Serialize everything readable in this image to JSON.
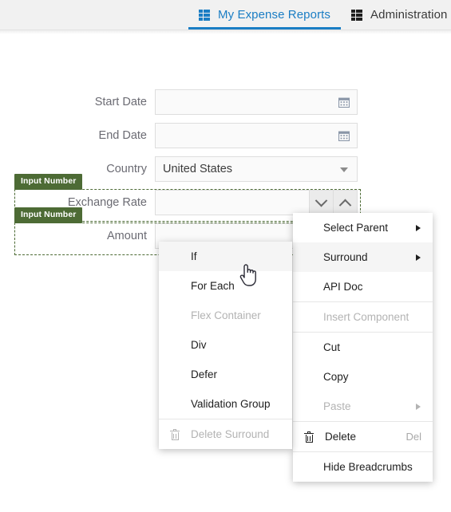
{
  "topbar": {
    "tabs": [
      {
        "label": "My Expense Reports",
        "icon": "grid-icon",
        "active": true
      },
      {
        "label": "Administration",
        "icon": "grid-icon",
        "active": false
      }
    ],
    "accent_color": "#1a7dc4"
  },
  "form": {
    "fields": [
      {
        "label": "Start Date",
        "value": "",
        "type": "date",
        "icon": "calendar-icon"
      },
      {
        "label": "End Date",
        "value": "",
        "type": "date",
        "icon": "calendar-icon"
      },
      {
        "label": "Country",
        "value": "United States",
        "type": "select",
        "icon": "chevron-down-icon"
      },
      {
        "label": "Exchange Rate",
        "value": "",
        "type": "number",
        "icon": "spinner-icon"
      },
      {
        "label": "Amount",
        "value": "",
        "type": "number",
        "icon": "spinner-icon"
      }
    ]
  },
  "designer": {
    "badges": [
      {
        "label": "Input Number"
      },
      {
        "label": "Input Number"
      }
    ],
    "selection_color": "#4d6b35"
  },
  "context_menu": {
    "items": [
      {
        "label": "Select Parent",
        "submenu": true,
        "disabled": false,
        "highlight": false,
        "accel": "",
        "icon": ""
      },
      {
        "label": "Surround",
        "submenu": true,
        "disabled": false,
        "highlight": true,
        "accel": "",
        "icon": ""
      },
      {
        "label": "API Doc",
        "submenu": false,
        "disabled": false,
        "highlight": false,
        "accel": "",
        "icon": ""
      },
      {
        "separator": true
      },
      {
        "label": "Insert Component",
        "submenu": false,
        "disabled": true,
        "highlight": false,
        "accel": "",
        "icon": ""
      },
      {
        "separator": true
      },
      {
        "label": "Cut",
        "submenu": false,
        "disabled": false,
        "highlight": false,
        "accel": "",
        "icon": ""
      },
      {
        "label": "Copy",
        "submenu": false,
        "disabled": false,
        "highlight": false,
        "accel": "",
        "icon": ""
      },
      {
        "label": "Paste",
        "submenu": true,
        "disabled": true,
        "highlight": false,
        "accel": "",
        "icon": ""
      },
      {
        "separator": true
      },
      {
        "label": "Delete",
        "submenu": false,
        "disabled": false,
        "highlight": false,
        "accel": "Del",
        "icon": "trash-icon"
      },
      {
        "separator": true
      },
      {
        "label": "Hide Breadcrumbs",
        "submenu": false,
        "disabled": false,
        "highlight": false,
        "accel": "",
        "icon": ""
      }
    ]
  },
  "surround_menu": {
    "items": [
      {
        "label": "If",
        "disabled": false,
        "highlight": true,
        "icon": ""
      },
      {
        "label": "For Each",
        "disabled": false,
        "highlight": false,
        "icon": ""
      },
      {
        "label": "Flex Container",
        "disabled": true,
        "highlight": false,
        "icon": ""
      },
      {
        "label": "Div",
        "disabled": false,
        "highlight": false,
        "icon": ""
      },
      {
        "label": "Defer",
        "disabled": false,
        "highlight": false,
        "icon": ""
      },
      {
        "label": "Validation Group",
        "disabled": false,
        "highlight": false,
        "icon": ""
      },
      {
        "separator": true
      },
      {
        "label": "Delete Surround",
        "disabled": true,
        "highlight": false,
        "icon": "trash-icon"
      }
    ]
  },
  "cursor": {
    "type": "pointing-hand"
  }
}
